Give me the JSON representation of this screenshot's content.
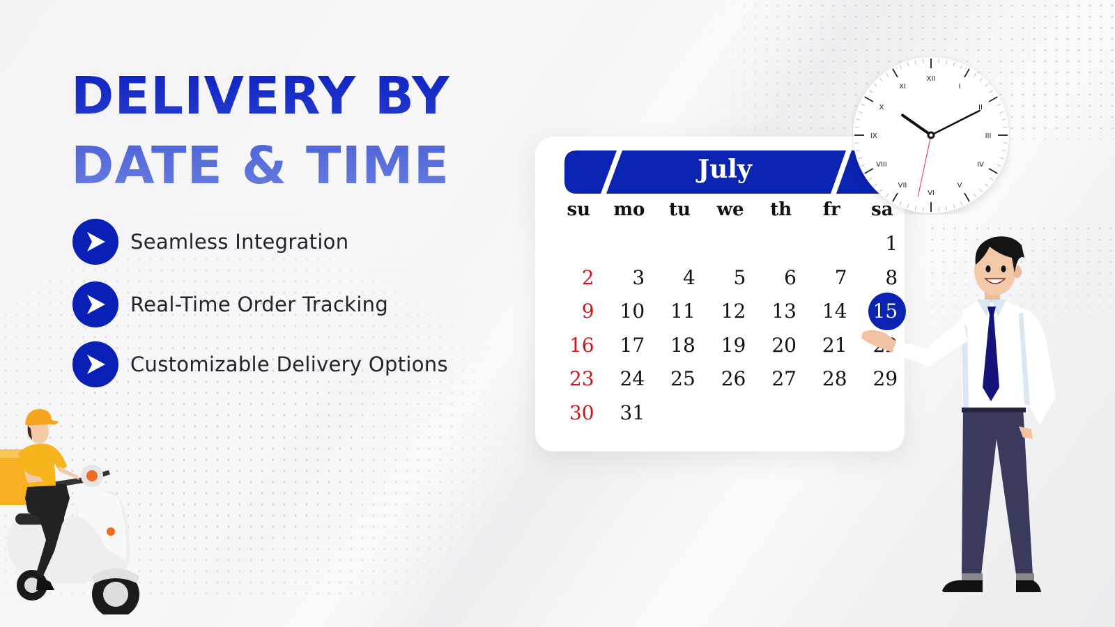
{
  "headline": {
    "line1": "DELIVERY BY",
    "line2": "DATE & TIME"
  },
  "features": [
    {
      "icon": "chevron-right-icon",
      "label": "Seamless Integration"
    },
    {
      "icon": "chevron-right-icon",
      "label": "Real-Time Order Tracking"
    },
    {
      "icon": "chevron-right-icon",
      "label": "Customizable Delivery Options"
    }
  ],
  "calendar": {
    "month": "July",
    "weekdays": [
      "su",
      "mo",
      "tu",
      "we",
      "th",
      "fr",
      "sa"
    ],
    "weeks": [
      [
        "",
        "",
        "",
        "",
        "",
        "",
        "1"
      ],
      [
        "2",
        "3",
        "4",
        "5",
        "6",
        "7",
        "8"
      ],
      [
        "9",
        "10",
        "11",
        "12",
        "13",
        "14",
        "15"
      ],
      [
        "16",
        "17",
        "18",
        "19",
        "20",
        "21",
        "22"
      ],
      [
        "23",
        "24",
        "25",
        "26",
        "27",
        "28",
        "29"
      ],
      [
        "30",
        "31",
        "",
        "",
        "",
        "",
        ""
      ]
    ],
    "selected_day": "15",
    "colors": {
      "header": "#0a23b0",
      "sunday": "#d0121b",
      "selected": "#0a23b0"
    }
  },
  "clock": {
    "numerals": [
      "XII",
      "I",
      "II",
      "III",
      "IV",
      "V",
      "VI",
      "VII",
      "VIII",
      "IX",
      "X",
      "XI"
    ],
    "time_shown": "10:10:32"
  },
  "colors": {
    "brand_blue": "#0a1fb5",
    "headline_light": "#5068d8",
    "text_dark": "#23232b"
  }
}
